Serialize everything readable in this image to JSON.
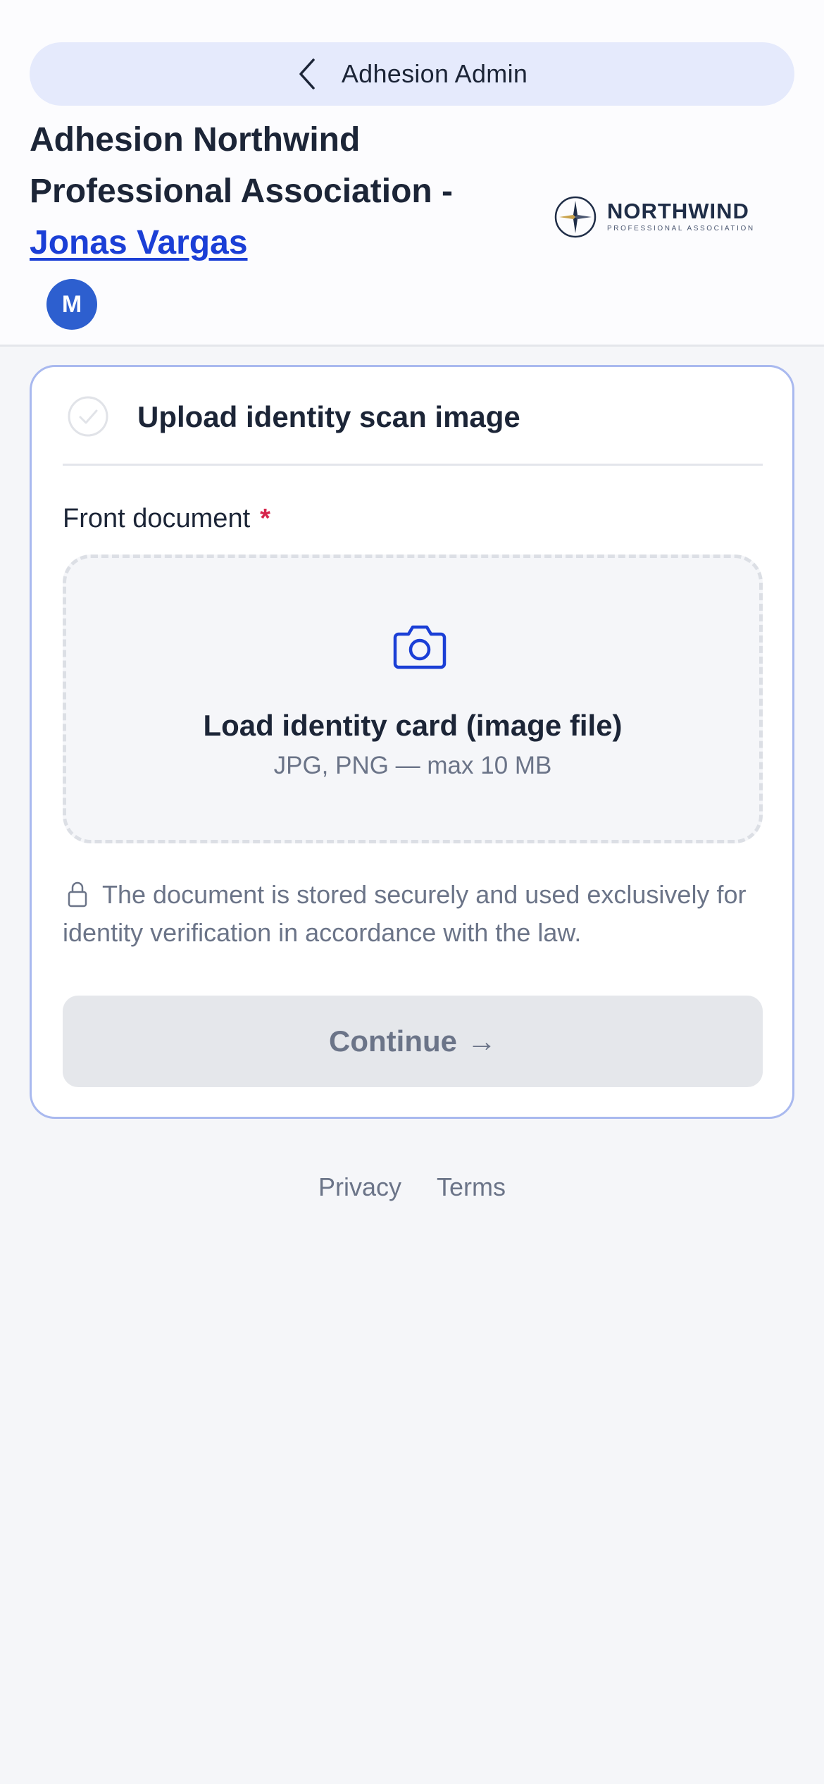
{
  "header": {
    "back_label": "Adhesion Admin",
    "title_line1": "Adhesion Northwind",
    "title_line2": "Professional Association -",
    "user_name": "Jonas Vargas",
    "avatar_initial": "M",
    "logo_name": "NORTHWIND",
    "logo_sub": "PROFESSIONAL ASSOCIATION"
  },
  "card": {
    "step_title": "Upload identity scan image",
    "field_label": "Front document",
    "required_marker": "*",
    "dropzone_title": "Load identity card (image file)",
    "dropzone_hint": "JPG, PNG — max 10 MB",
    "notice": "The document is stored securely and used exclusively for identity verification in accordance with the law.",
    "continue_label": "Continue",
    "continue_arrow": "→"
  },
  "footer": {
    "privacy": "Privacy",
    "terms": "Terms"
  },
  "colors": {
    "accent": "#1b3fd6",
    "avatar": "#2d5fcf",
    "required": "#d6254b",
    "pill_bg": "#e5eafc",
    "card_border": "#a9b9ef"
  },
  "icons": {
    "back": "chevron-left-icon",
    "step": "check-circle-icon",
    "upload": "camera-icon",
    "notice": "lock-icon",
    "logo": "compass-star-icon"
  }
}
